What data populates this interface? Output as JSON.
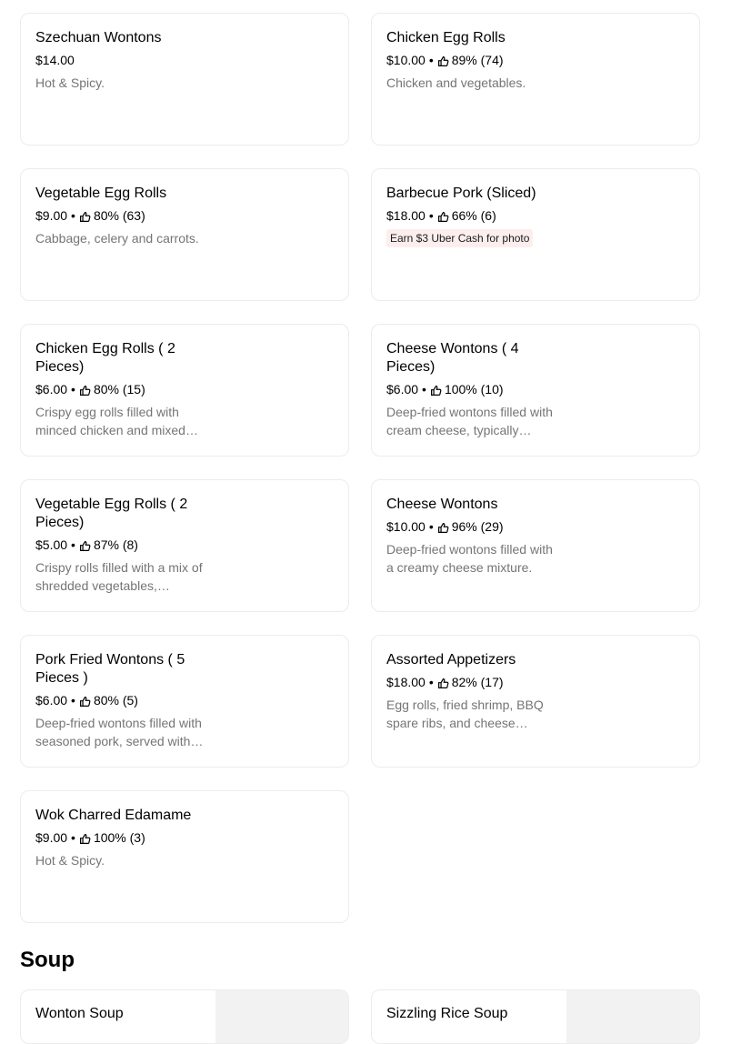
{
  "items": [
    {
      "name": "Szechuan Wontons",
      "price": "$14.00",
      "rating": "",
      "desc": "Hot & Spicy.",
      "promo": ""
    },
    {
      "name": "Chicken Egg Rolls",
      "price": "$10.00",
      "rating": "89% (74)",
      "desc": "Chicken and vegetables.",
      "promo": ""
    },
    {
      "name": "Vegetable Egg Rolls",
      "price": "$9.00",
      "rating": "80% (63)",
      "desc": "Cabbage, celery and carrots.",
      "promo": ""
    },
    {
      "name": "Barbecue Pork (Sliced)",
      "price": "$18.00",
      "rating": "66% (6)",
      "desc": "",
      "promo": "Earn $3 Uber Cash for photo"
    },
    {
      "name": "Chicken Egg Rolls ( 2 Pieces)",
      "price": "$6.00",
      "rating": "80% (15)",
      "desc": "Crispy egg rolls filled with minced chicken and mixed vegetables.",
      "promo": ""
    },
    {
      "name": "Cheese Wontons ( 4 Pieces)",
      "price": "$6.00",
      "rating": "100% (10)",
      "desc": "Deep-fried wontons filled with cream cheese, typically served with sauce.",
      "promo": ""
    },
    {
      "name": "Vegetable Egg Rolls ( 2 Pieces)",
      "price": "$5.00",
      "rating": "87% (8)",
      "desc": "Crispy rolls filled with a mix of shredded vegetables, wrapped and fried.",
      "promo": ""
    },
    {
      "name": "Cheese Wontons",
      "price": "$10.00",
      "rating": "96% (29)",
      "desc": "Deep-fried wontons filled with a creamy cheese mixture.",
      "promo": ""
    },
    {
      "name": "Pork Fried Wontons ( 5 Pieces )",
      "price": "$6.00",
      "rating": "80% (5)",
      "desc": "Deep-fried wontons filled with seasoned pork, served with sauce.",
      "promo": ""
    },
    {
      "name": "Assorted Appetizers",
      "price": "$18.00",
      "rating": "82% (17)",
      "desc": "Egg rolls, fried shrimp, BBQ spare ribs, and cheese wontons.",
      "promo": ""
    },
    {
      "name": "Wok Charred Edamame",
      "price": "$9.00",
      "rating": "100% (3)",
      "desc": "Hot & Spicy.",
      "promo": ""
    }
  ],
  "section_title": "Soup",
  "soup_items": [
    {
      "name": "Wonton Soup"
    },
    {
      "name": "Sizzling Rice Soup"
    }
  ],
  "rating_separator": "•",
  "icon": "thumbs-up-icon"
}
